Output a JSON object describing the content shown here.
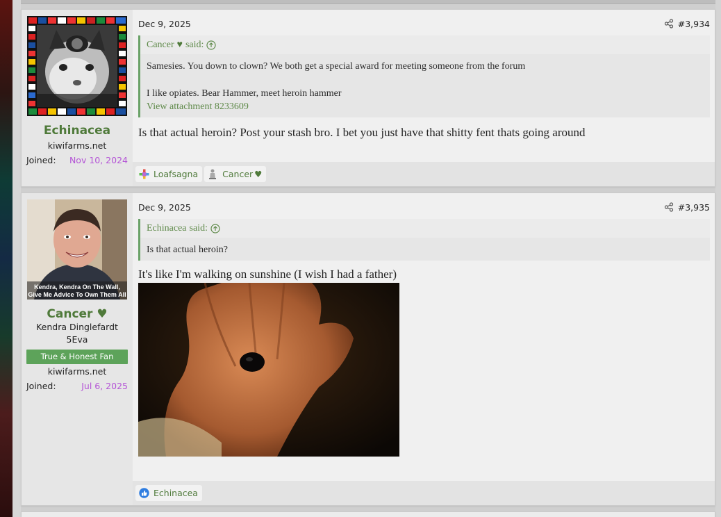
{
  "posts": [
    {
      "user": {
        "name": "Echinacea",
        "title": "",
        "banner": "",
        "site": "kiwifarms.net",
        "joined_label": "Joined:",
        "joined_date": "Nov 10, 2024",
        "avatar_icon": "cat-flags-avatar"
      },
      "date": "Dec 9, 2025",
      "number": "#3,934",
      "quote": {
        "author": "Cancer",
        "said": "said:",
        "lines": [
          "Samesies. You down to clown? We both get a special award for meeting someone from the forum",
          "I like opiates. Bear Hammer, meet heroin hammer"
        ],
        "attachment": "View attachment 8233609"
      },
      "message": "Is that actual heroin? Post your stash bro. I bet you just have that shitty fent thats going around",
      "reactions": [
        {
          "icon": "puzzle-icon",
          "label": "Loafsagna"
        },
        {
          "icon": "statue-icon",
          "label": "Cancer"
        }
      ]
    },
    {
      "user": {
        "name": "Cancer",
        "title_line1": "Kendra Dinglefardt",
        "title_line2": "5Eva",
        "banner": "True & Honest Fan",
        "site": "kiwifarms.net",
        "joined_label": "Joined:",
        "joined_date": "Jul 6, 2025",
        "avatar_caption1": "Kendra, Kendra On The Wall,",
        "avatar_caption2": "Give Me Advice To Own Them All"
      },
      "date": "Dec 9, 2025",
      "number": "#3,935",
      "quote": {
        "author": "Echinacea",
        "said": "said:",
        "lines": [
          "Is that actual heroin?"
        ]
      },
      "message": "It's like I'm walking on sunshine (I wish I had a father)",
      "image_icon": "hand-holding-tar-image",
      "reactions": [
        {
          "icon": "thumbs-up-icon",
          "label": "Echinacea"
        }
      ]
    }
  ],
  "colors": {
    "username": "#4f7a3a",
    "joined_date": "#b454d6",
    "banner": "#5da35a",
    "quote_border": "#6aa267"
  }
}
